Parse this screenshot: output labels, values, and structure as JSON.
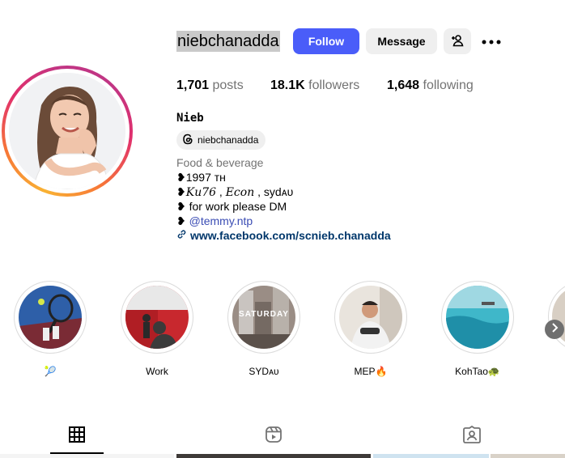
{
  "profile": {
    "username": "niebchanadda",
    "follow_label": "Follow",
    "message_label": "Message",
    "stats": {
      "posts_count": "1,701",
      "posts_label": "posts",
      "followers_count": "18.1K",
      "followers_label": "followers",
      "following_count": "1,648",
      "following_label": "following"
    },
    "display_name": "Nieb",
    "threads_handle": "niebchanadda",
    "category": "Food & beverage",
    "bio": {
      "line1_heart": "❥",
      "line1_text": "1997 ᴛʜ",
      "line2_heart": "❥",
      "line2_ku": "𝐾𝑢76",
      "line2_sep1": " , ",
      "line2_econ": "𝐸𝑐𝑜𝑛",
      "line2_sep2": " , syd",
      "line2_au": "ᴀᴜ",
      "line3_heart": "❥",
      "line3_text": " for work please DM",
      "line4_heart": "❥",
      "line4_mention": "@temmy.ntp"
    },
    "link": "www.facebook.com/scnieb.chanadda"
  },
  "highlights": [
    {
      "label": "🎾"
    },
    {
      "label": "Work"
    },
    {
      "label": "SYDᴀᴜ",
      "overlay_text": "SATURDAY"
    },
    {
      "label": "MEP🔥"
    },
    {
      "label": "KohTao🐢"
    }
  ],
  "icons": {
    "add_user": "add-person-icon",
    "more": "more-horizontal-icon",
    "threads": "threads-icon",
    "link": "link-icon",
    "next": "chevron-right-icon",
    "tab_posts": "grid-icon",
    "tab_reels": "reels-icon",
    "tab_tagged": "tagged-icon"
  },
  "colors": {
    "follow_button": "#4a5df9",
    "secondary_button": "#efefef",
    "link": "#00376b",
    "mention": "#3a4cb4"
  }
}
